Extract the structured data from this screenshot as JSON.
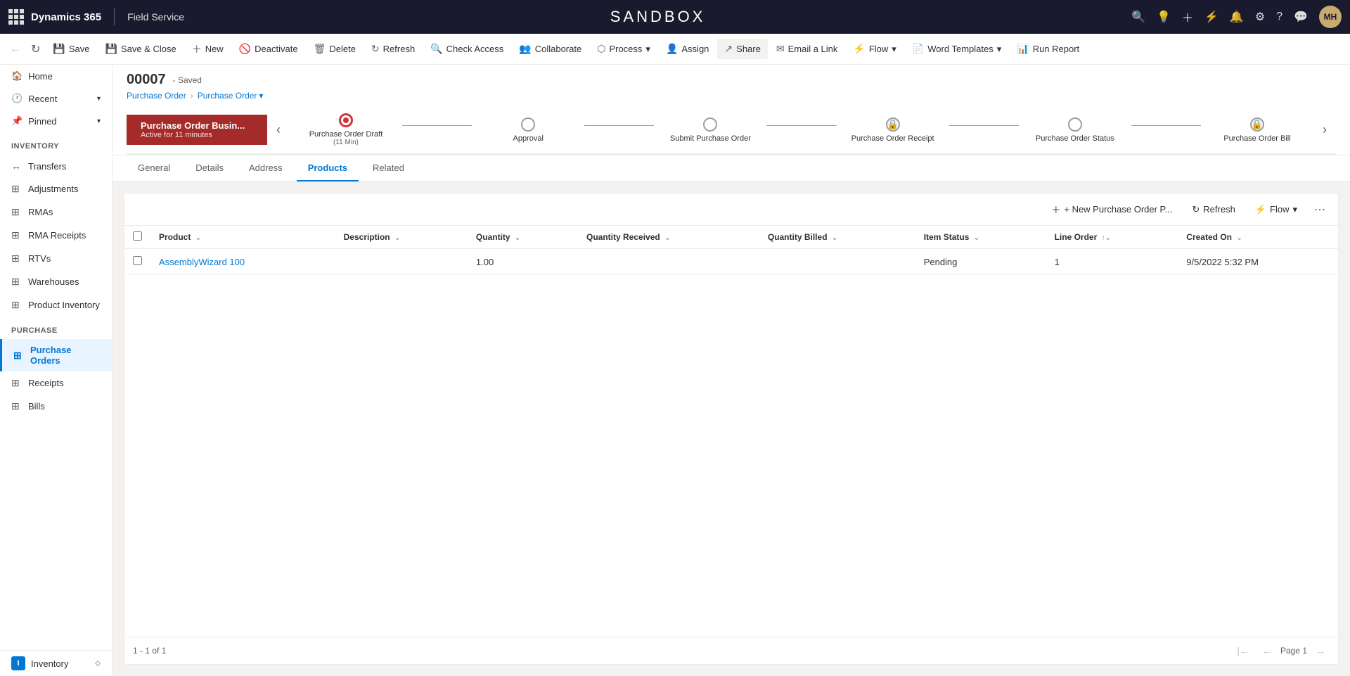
{
  "topnav": {
    "app": "Dynamics 365",
    "divider": "|",
    "module": "Field Service",
    "sandbox": "SANDBOX",
    "avatar": "MH"
  },
  "toolbar": {
    "back_label": "←",
    "forward_label": "↻",
    "save": "Save",
    "save_close": "Save & Close",
    "new": "New",
    "deactivate": "Deactivate",
    "delete": "Delete",
    "refresh": "Refresh",
    "check_access": "Check Access",
    "collaborate": "Collaborate",
    "process": "Process",
    "assign": "Assign",
    "share": "Share",
    "email_link": "Email a Link",
    "flow": "Flow",
    "word_templates": "Word Templates",
    "run_report": "Run Report"
  },
  "record": {
    "id": "00007",
    "status": "- Saved",
    "breadcrumb1": "Purchase Order",
    "breadcrumb2": "Purchase Order"
  },
  "process_stages": [
    {
      "label": "Purchase Order Draft",
      "sublabel": "(11 Min)",
      "state": "active"
    },
    {
      "label": "Approval",
      "sublabel": "",
      "state": "pending"
    },
    {
      "label": "Submit Purchase Order",
      "sublabel": "",
      "state": "pending"
    },
    {
      "label": "Purchase Order Receipt",
      "sublabel": "",
      "state": "locked"
    },
    {
      "label": "Purchase Order Status",
      "sublabel": "",
      "state": "pending"
    },
    {
      "label": "Purchase Order Bill",
      "sublabel": "",
      "state": "locked"
    }
  ],
  "active_stage": {
    "title": "Purchase Order Busin...",
    "subtitle": "Active for 11 minutes"
  },
  "tabs": [
    {
      "label": "General",
      "active": false
    },
    {
      "label": "Details",
      "active": false
    },
    {
      "label": "Address",
      "active": false
    },
    {
      "label": "Products",
      "active": true
    },
    {
      "label": "Related",
      "active": false
    }
  ],
  "grid": {
    "new_button": "+ New Purchase Order P...",
    "refresh_button": "Refresh",
    "flow_button": "Flow",
    "columns": [
      {
        "key": "product",
        "label": "Product",
        "sortable": true
      },
      {
        "key": "description",
        "label": "Description",
        "sortable": true
      },
      {
        "key": "quantity",
        "label": "Quantity",
        "sortable": true
      },
      {
        "key": "quantity_received",
        "label": "Quantity Received",
        "sortable": true
      },
      {
        "key": "quantity_billed",
        "label": "Quantity Billed",
        "sortable": true
      },
      {
        "key": "item_status",
        "label": "Item Status",
        "sortable": true
      },
      {
        "key": "line_order",
        "label": "Line Order",
        "sortable": true
      },
      {
        "key": "created_on",
        "label": "Created On",
        "sortable": true
      }
    ],
    "rows": [
      {
        "product": "AssemblyWizard 100",
        "description": "",
        "quantity": "1.00",
        "quantity_received": "",
        "quantity_billed": "",
        "item_status": "Pending",
        "line_order": "1",
        "created_on": "9/5/2022 5:32 PM"
      }
    ],
    "record_count": "1 - 1 of 1",
    "page_label": "Page 1"
  },
  "sidebar": {
    "home": "Home",
    "recent": "Recent",
    "pinned": "Pinned",
    "sections": [
      {
        "label": "Inventory",
        "items": [
          "Transfers",
          "Adjustments",
          "RMAs",
          "RMA Receipts",
          "RTVs",
          "Warehouses",
          "Product Inventory"
        ]
      },
      {
        "label": "Purchase",
        "items": [
          "Purchase Orders",
          "Receipts",
          "Bills"
        ]
      }
    ],
    "bottom_label": "Inventory",
    "bottom_badge": "I"
  }
}
